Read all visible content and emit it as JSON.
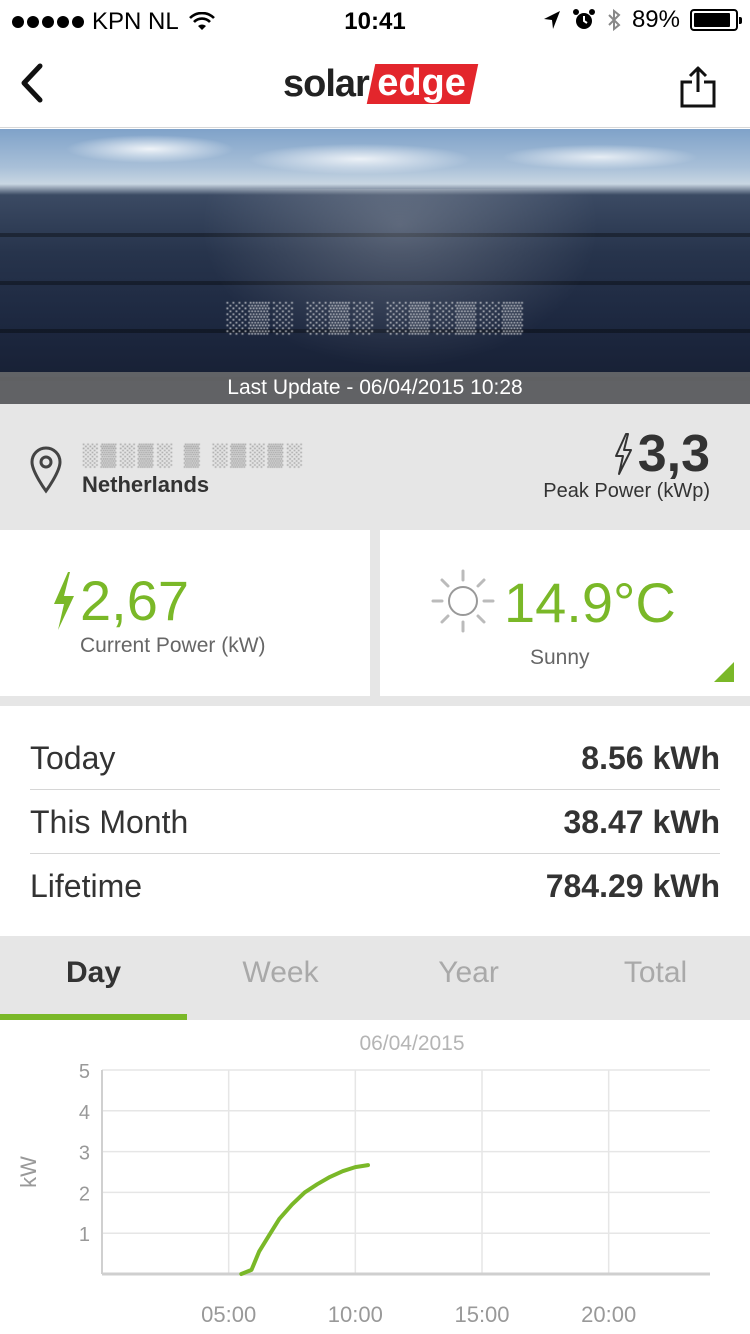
{
  "status_bar": {
    "carrier": "KPN NL",
    "time": "10:41",
    "battery": "89%",
    "battery_level": 0.89
  },
  "nav": {
    "logo_solar": "solar",
    "logo_edge": "edge"
  },
  "hero": {
    "site_name": "░▒░ ░▒░ ░▒░▒░▒",
    "last_update": "Last Update - 06/04/2015 10:28"
  },
  "location": {
    "address": "░▒░▒░ ▒ ░▒░▒░",
    "country": "Netherlands",
    "peak_value": "3,3",
    "peak_label": "Peak Power (kWp)"
  },
  "current_power": {
    "value": "2,67",
    "label": "Current Power (kW)"
  },
  "weather": {
    "temperature": "14.9°C",
    "description": "Sunny"
  },
  "energy": [
    {
      "label": "Today",
      "value": "8.56 kWh"
    },
    {
      "label": "This Month",
      "value": "38.47 kWh"
    },
    {
      "label": "Lifetime",
      "value": "784.29 kWh"
    }
  ],
  "tabs": [
    {
      "label": "Day",
      "active": true
    },
    {
      "label": "Week",
      "active": false
    },
    {
      "label": "Year",
      "active": false
    },
    {
      "label": "Total",
      "active": false
    }
  ],
  "colors": {
    "accent": "#7ab828",
    "brand_red": "#e3262c"
  },
  "chart_data": {
    "type": "line",
    "title": "06/04/2015",
    "ylabel": "kW",
    "xlabel": "",
    "xlim": [
      0,
      24
    ],
    "ylim": [
      0,
      5
    ],
    "x_ticks": [
      5,
      10,
      15,
      20
    ],
    "x_tick_labels": [
      "05:00",
      "10:00",
      "15:00",
      "20:00"
    ],
    "y_ticks": [
      1,
      2,
      3,
      4,
      5
    ],
    "y_tick_labels": [
      "1",
      "2",
      "3",
      "4",
      "5"
    ],
    "grid": true,
    "series": [
      {
        "color": "#7ab828",
        "x": [
          5.5,
          5.9,
          6.2,
          6.6,
          7.0,
          7.5,
          8.0,
          8.5,
          9.0,
          9.5,
          10.0,
          10.5
        ],
        "y": [
          0.0,
          0.1,
          0.55,
          0.95,
          1.35,
          1.7,
          2.0,
          2.2,
          2.38,
          2.52,
          2.62,
          2.67
        ]
      }
    ]
  }
}
